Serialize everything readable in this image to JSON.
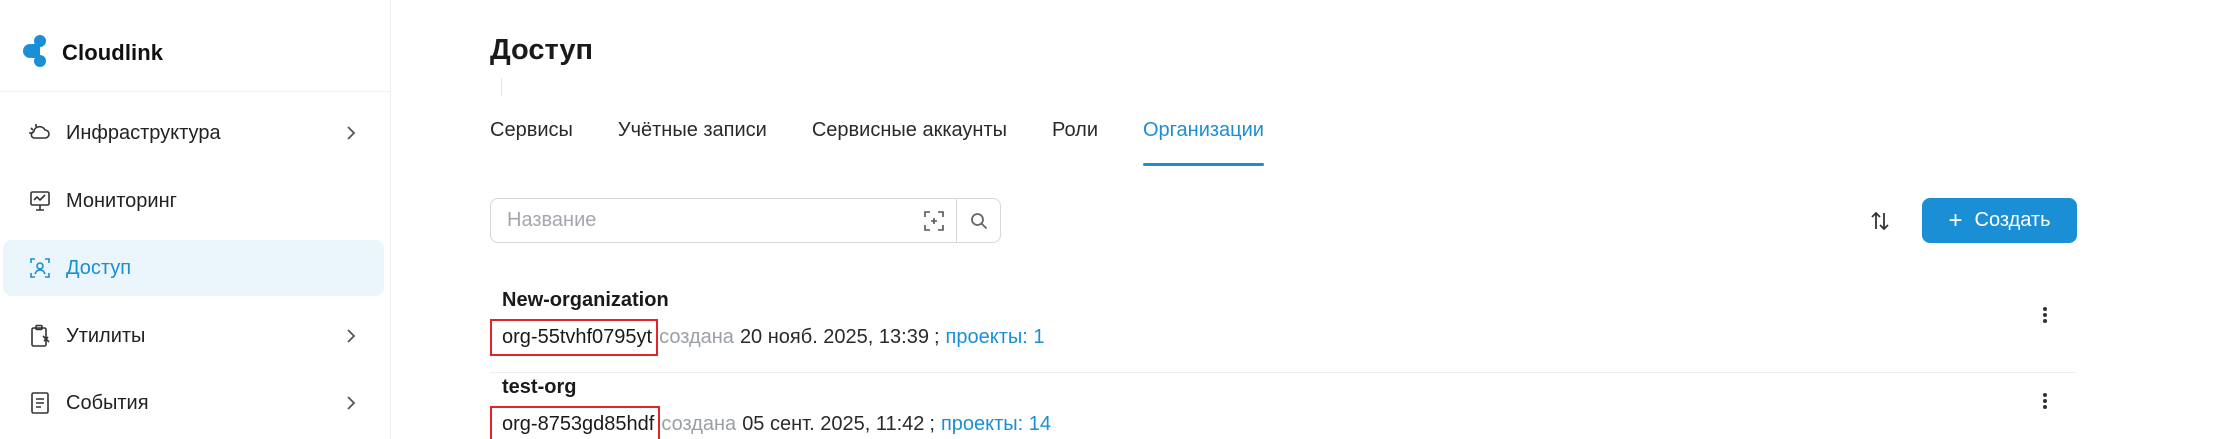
{
  "app": {
    "logo_text": "Cloudlink",
    "brand_color": "#1a8fd6"
  },
  "sidebar": {
    "items": [
      {
        "label": "Инфраструктура",
        "icon": "cloud-infrastructure-icon",
        "has_chevron": true,
        "active": false
      },
      {
        "label": "Мониторинг",
        "icon": "monitor-icon",
        "has_chevron": false,
        "active": false
      },
      {
        "label": "Доступ",
        "icon": "access-icon",
        "has_chevron": false,
        "active": true
      },
      {
        "label": "Утилиты",
        "icon": "clipboard-tools-icon",
        "has_chevron": true,
        "active": false
      },
      {
        "label": "События",
        "icon": "events-list-icon",
        "has_chevron": true,
        "active": false
      }
    ]
  },
  "page": {
    "title": "Доступ"
  },
  "tabs": [
    {
      "label": "Сервисы",
      "active": false
    },
    {
      "label": "Учётные записи",
      "active": false
    },
    {
      "label": "Сервисные аккаунты",
      "active": false
    },
    {
      "label": "Роли",
      "active": false
    },
    {
      "label": "Организации",
      "active": true
    }
  ],
  "toolbar": {
    "search_placeholder": "Название",
    "create_label": "Создать",
    "create_icon": "+"
  },
  "organizations": [
    {
      "name": "New-organization",
      "id": "org-55tvhf0795yt",
      "created_label": "создана",
      "created_at": "20 нояб. 2025, 13:39",
      "separator": ";",
      "projects": "проекты: 1"
    },
    {
      "name": "test-org",
      "id": "org-8753gd85hdf",
      "created_label": "создана",
      "created_at": "05 сент. 2025, 11:42",
      "separator": ";",
      "projects": "проекты: 14"
    }
  ]
}
